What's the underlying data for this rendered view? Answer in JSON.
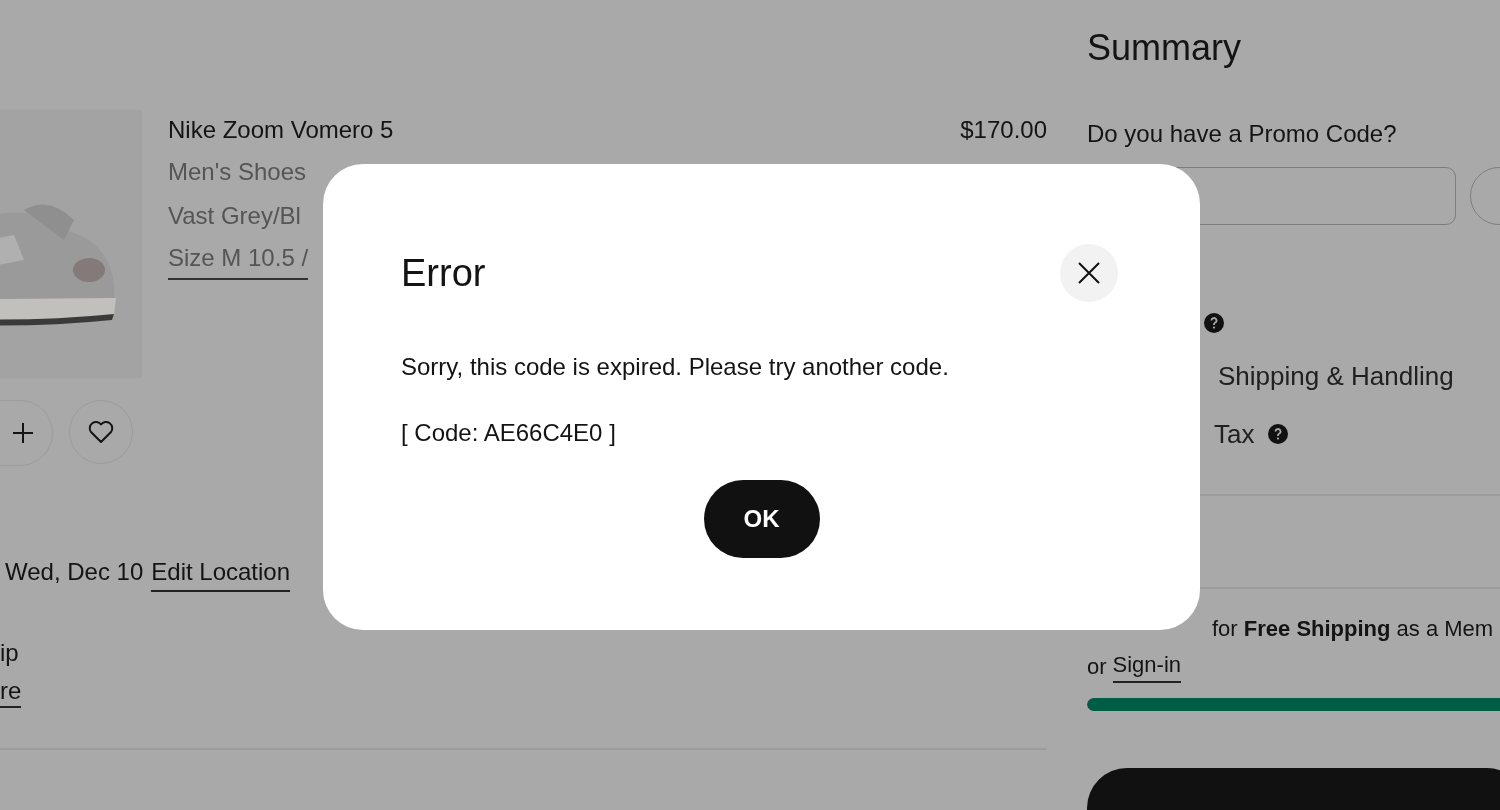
{
  "cart_item": {
    "name": "Nike Zoom Vomero 5",
    "category": "Men's Shoes",
    "colorway": "Vast Grey/Bl",
    "size": "Size M 10.5 /",
    "price": "$170.00"
  },
  "delivery": {
    "date": "Wed, Dec 10",
    "link": "Edit Location"
  },
  "pickup": {
    "line": "ip",
    "link": "re"
  },
  "summary": {
    "title": "Summary",
    "promo_question": "Do you have a Promo Code?",
    "shipping_label": "Shipping & Handling",
    "tax_label": "Tax",
    "free_shipping_note": "for **Free Shipping** as a Mem",
    "sign_in_prefix": "or",
    "sign_in_link": "Sign-in",
    "progress": {
      "level": 1
    }
  },
  "dialog": {
    "title": "Error",
    "message": "Sorry, this code is expired. Please try another code.",
    "code": "[ Code: AE66C4E0 ]",
    "button": "OK"
  }
}
